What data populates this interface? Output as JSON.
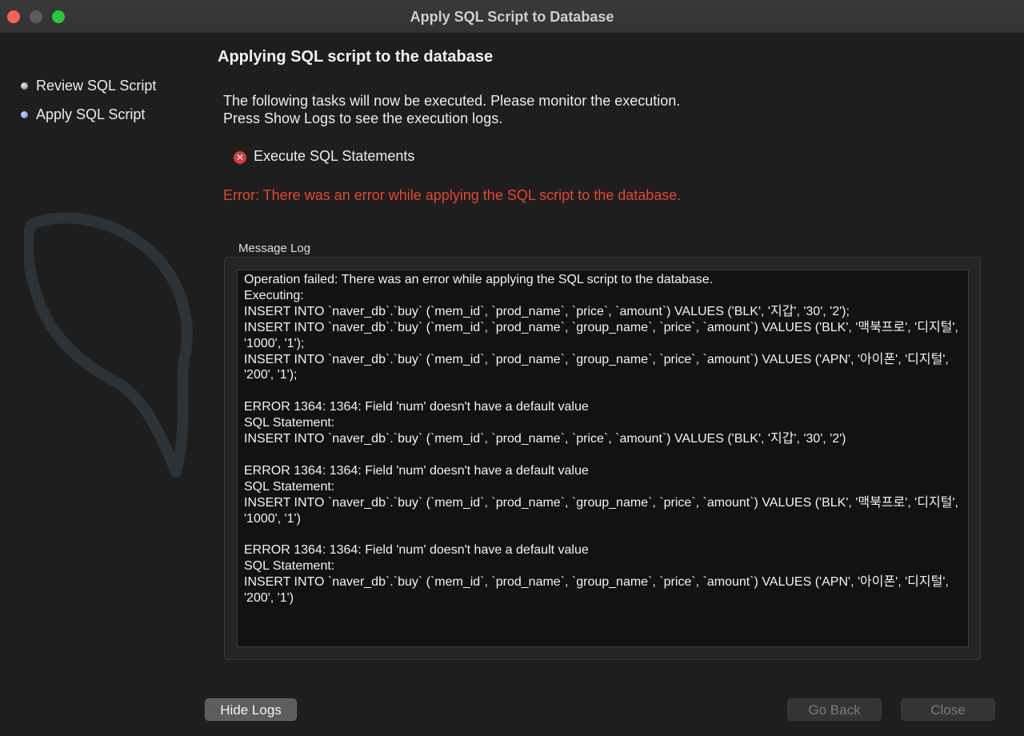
{
  "window": {
    "title": "Apply SQL Script to Database"
  },
  "sidebar": {
    "steps": [
      {
        "label": "Review SQL Script",
        "state": "done"
      },
      {
        "label": "Apply SQL Script",
        "state": "current"
      }
    ]
  },
  "main": {
    "title": "Applying SQL script to the database",
    "description_line1": "The following tasks will now be executed. Please monitor the execution.",
    "description_line2": "Press Show Logs to see the execution logs.",
    "task": {
      "label": "Execute SQL Statements",
      "status": "error",
      "icon": "error-x-icon"
    },
    "error_message": "Error: There was an error while applying the SQL script to the database.",
    "log_label": "Message Log",
    "log_text": "Operation failed: There was an error while applying the SQL script to the database.\nExecuting:\nINSERT INTO `naver_db`.`buy` (`mem_id`, `prod_name`, `price`, `amount`) VALUES ('BLK', '지갑', '30', '2');\nINSERT INTO `naver_db`.`buy` (`mem_id`, `prod_name`, `group_name`, `price`, `amount`) VALUES ('BLK', '맥북프로', '디지털', '1000', '1');\nINSERT INTO `naver_db`.`buy` (`mem_id`, `prod_name`, `group_name`, `price`, `amount`) VALUES ('APN', '아이폰', '디지털', '200', '1');\n\nERROR 1364: 1364: Field 'num' doesn't have a default value\nSQL Statement:\nINSERT INTO `naver_db`.`buy` (`mem_id`, `prod_name`, `price`, `amount`) VALUES ('BLK', '지갑', '30', '2')\n\nERROR 1364: 1364: Field 'num' doesn't have a default value\nSQL Statement:\nINSERT INTO `naver_db`.`buy` (`mem_id`, `prod_name`, `group_name`, `price`, `amount`) VALUES ('BLK', '맥북프로', '디지털', '1000', '1')\n\nERROR 1364: 1364: Field 'num' doesn't have a default value\nSQL Statement:\nINSERT INTO `naver_db`.`buy` (`mem_id`, `prod_name`, `group_name`, `price`, `amount`) VALUES ('APN', '아이폰', '디지털', '200', '1')"
  },
  "footer": {
    "hide_logs_label": "Hide Logs",
    "go_back_label": "Go Back",
    "close_label": "Close"
  },
  "colors": {
    "error": "#e8452f",
    "background": "#1e1e1e",
    "log_background": "#121212"
  }
}
